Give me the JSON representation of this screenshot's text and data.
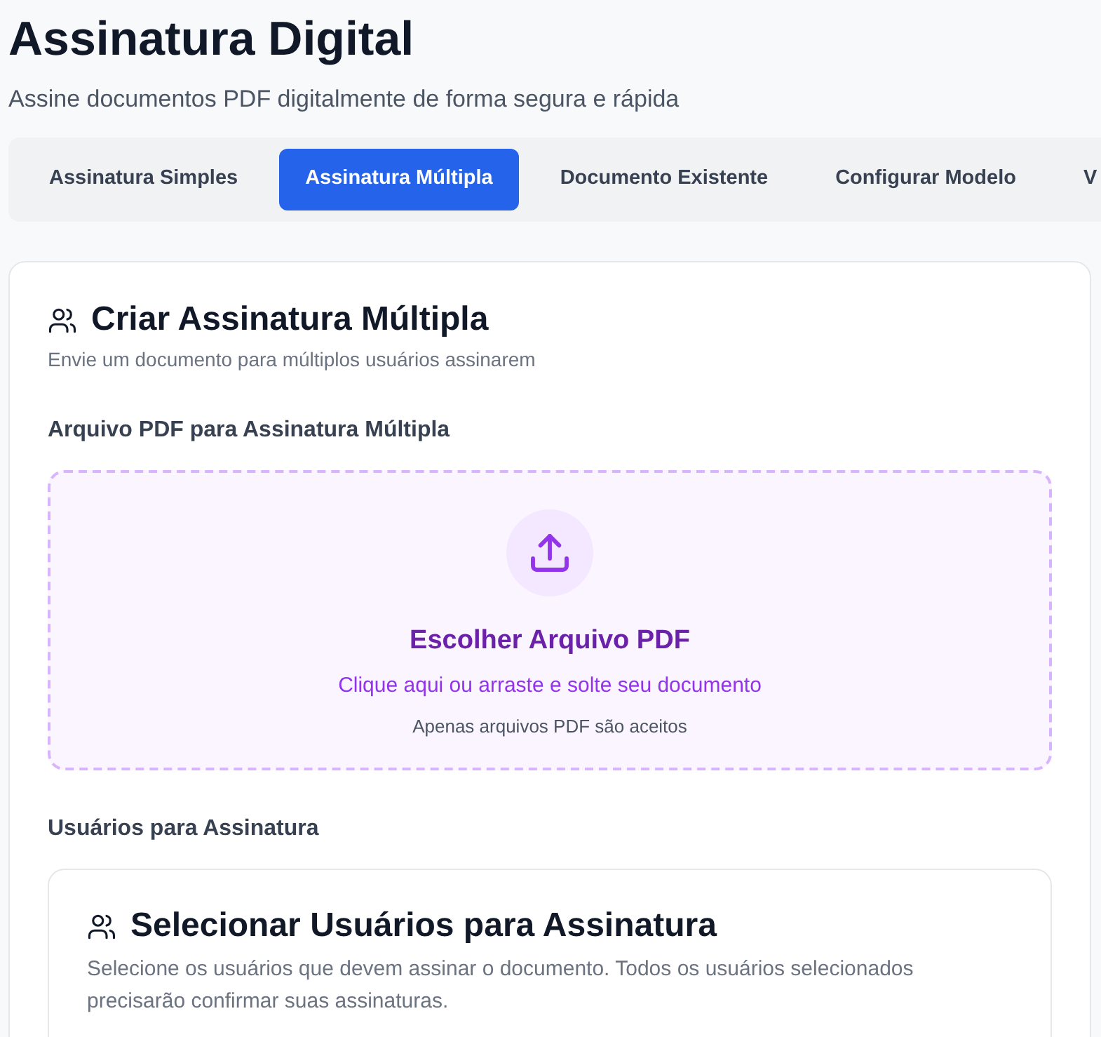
{
  "header": {
    "title": "Assinatura Digital",
    "subtitle": "Assine documentos PDF digitalmente de forma segura e rápida"
  },
  "tabs": [
    {
      "label": "Assinatura Simples",
      "selected": false
    },
    {
      "label": "Assinatura Múltipla",
      "selected": true
    },
    {
      "label": "Documento Existente",
      "selected": false
    },
    {
      "label": "Configurar Modelo",
      "selected": false
    },
    {
      "label": "V",
      "selected": false
    }
  ],
  "card": {
    "title": "Criar Assinatura Múltipla",
    "description": "Envie um documento para múltiplos usuários assinarem",
    "file_label": "Arquivo PDF para Assinatura Múltipla",
    "dropzone": {
      "title": "Escolher Arquivo PDF",
      "hint": "Clique aqui ou arraste e solte seu documento",
      "note": "Apenas arquivos PDF são aceitos"
    },
    "users_label": "Usuários para Assinatura",
    "users_panel": {
      "title": "Selecionar Usuários para Assinatura",
      "description": "Selecione os usuários que devem assinar o documento. Todos os usuários selecionados precisarão confirmar suas assinaturas."
    }
  }
}
